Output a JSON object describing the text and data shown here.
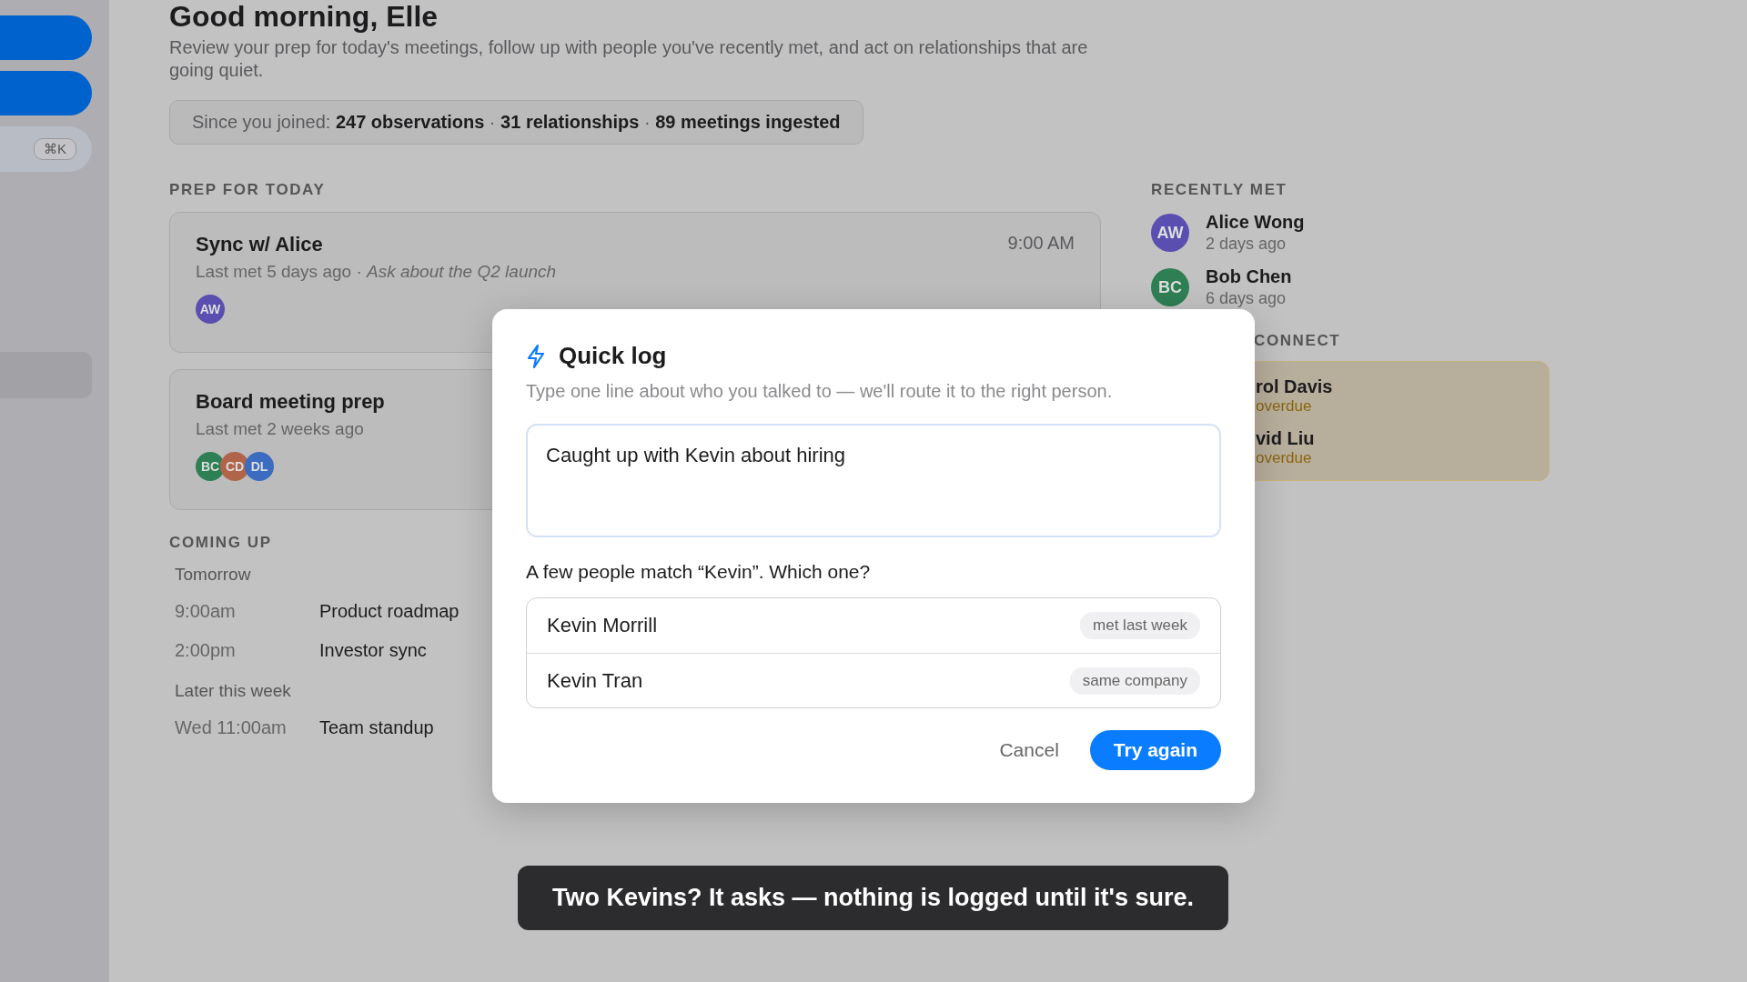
{
  "sidebar": {
    "shortcut": "⌘K"
  },
  "header": {
    "title": "Good morning, Elle",
    "intro": "Review your prep for today's meetings, follow up with people you've recently met, and act on relationships that are going quiet.",
    "stats": "Since you joined: **247 observations** · **31 relationships** · **89 meetings ingested**"
  },
  "prep": {
    "heading": "PREP FOR TODAY",
    "cards": [
      {
        "title": "Sync w/ Alice",
        "time": "9:00 AM",
        "detail": "Last met 5 days ago · *Ask about the Q2 launch*",
        "attendees": [
          {
            "initials": "AW",
            "color": "#5a4fb0"
          }
        ]
      },
      {
        "title": "Board meeting prep",
        "detail": "Last met 2 weeks ago",
        "attendees": [
          {
            "initials": "BC",
            "color": "#2f7f55"
          },
          {
            "initials": "CD",
            "color": "#b0654a"
          },
          {
            "initials": "DL",
            "color": "#3b6cc0"
          }
        ]
      }
    ]
  },
  "coming_up": {
    "heading": "COMING UP",
    "groups": [
      {
        "label": "Tomorrow",
        "events": [
          {
            "time": "9:00am",
            "title": "Product roadmap"
          },
          {
            "time": "2:00pm",
            "title": "Investor sync"
          }
        ]
      },
      {
        "label": "Later this week",
        "events": [
          {
            "time": "Wed 11:00am",
            "title": "Team standup"
          }
        ]
      }
    ]
  },
  "recently_met": {
    "heading": "RECENTLY MET",
    "people": [
      {
        "initials": "AW",
        "color": "#5a4fb0",
        "name": "Alice Wong",
        "when": "2 days ago"
      },
      {
        "initials": "BC",
        "color": "#2f7f55",
        "name": "Bob Chen",
        "when": "6 days ago"
      }
    ]
  },
  "reconnect": {
    "heading": "CONNECT",
    "people": [
      {
        "name": "rol Davis",
        "status": "overdue"
      },
      {
        "name": "vid Liu",
        "status": "overdue"
      }
    ]
  },
  "modal": {
    "title": "Quick log",
    "subtitle": "Type one line about who you talked to — we'll route it to the right person.",
    "value": "Caught up with Kevin about hiring",
    "question": "A few people match “Kevin”. Which one?",
    "matches": [
      {
        "name": "Kevin Morrill",
        "tag": "met last week"
      },
      {
        "name": "Kevin Tran",
        "tag": "same company"
      }
    ],
    "buttons": [
      {
        "kind": "secondary",
        "label": "Cancel"
      },
      {
        "kind": "primary",
        "label": "Try again"
      }
    ]
  },
  "toast": "Two Kevins? It asks — nothing is logged until it's sure."
}
